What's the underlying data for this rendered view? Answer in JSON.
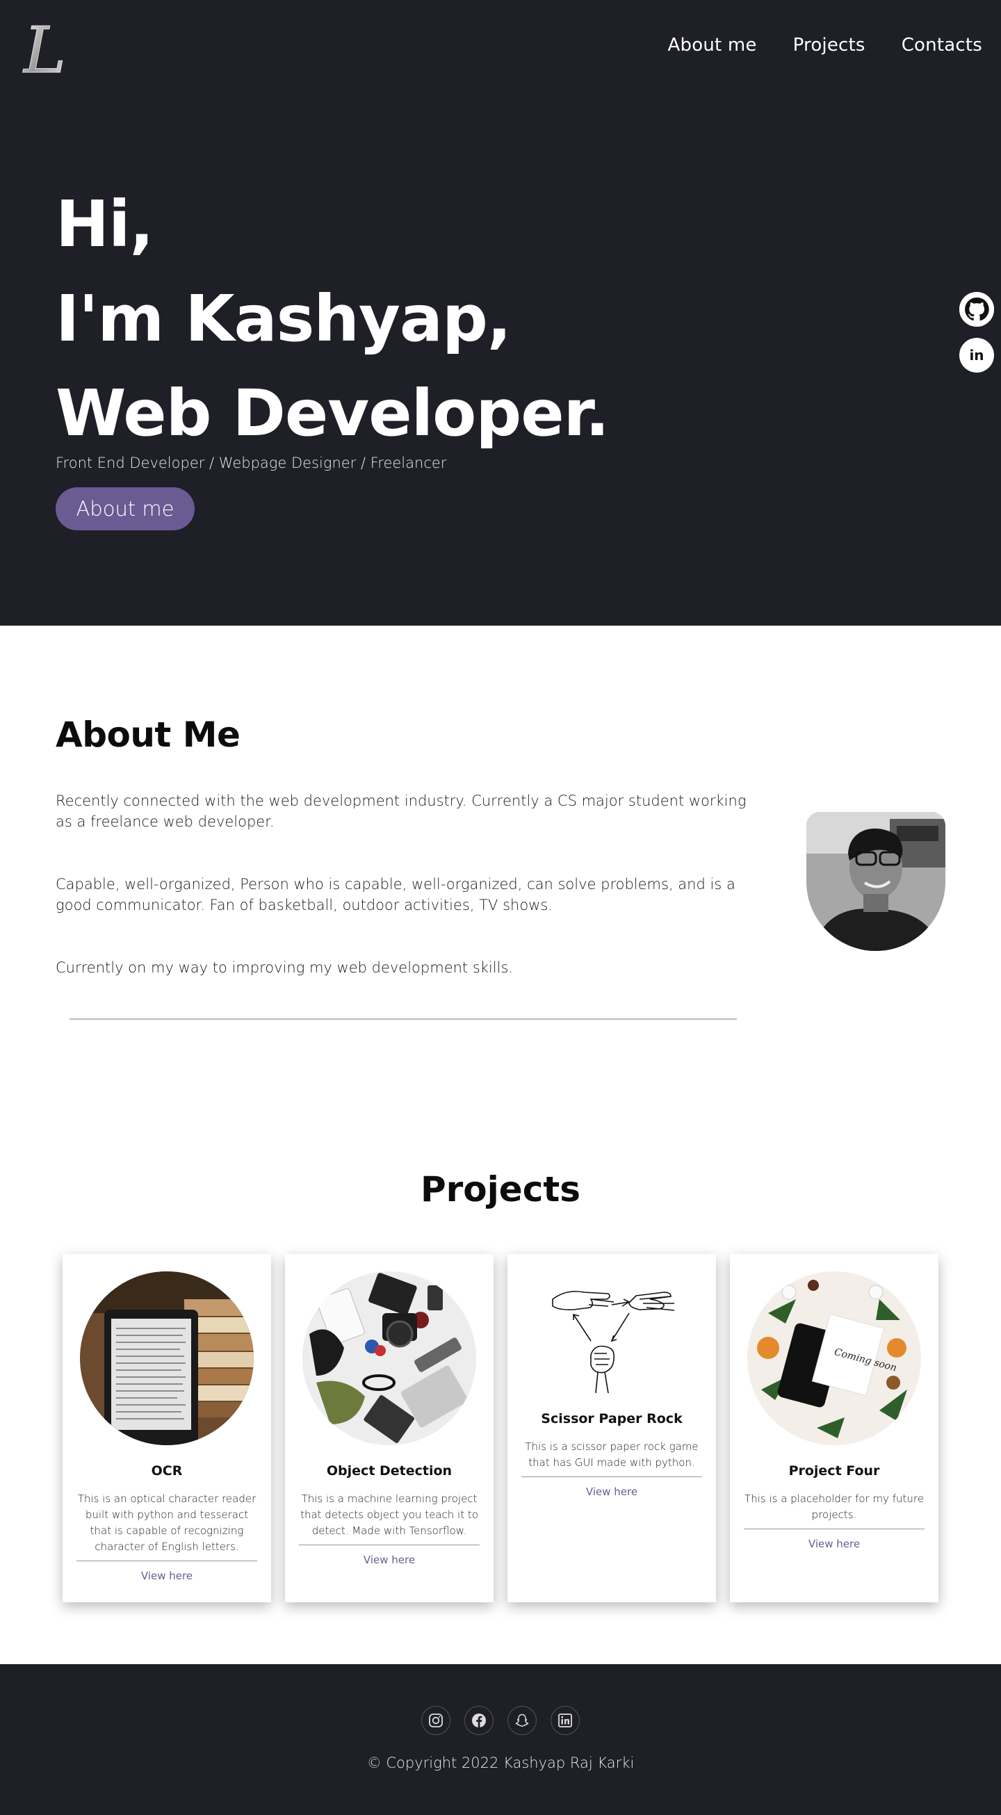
{
  "nav": {
    "logo_letter": "L",
    "links": [
      "About me",
      "Projects",
      "Contacts"
    ]
  },
  "hero": {
    "line1": "Hi,",
    "line2": "I'm Kashyap,",
    "line3": "Web Developer.",
    "subtitle": "Front End Developer / Webpage Designer / Freelancer",
    "button": "About me",
    "side_icons": [
      "github-icon",
      "linkedin-icon"
    ],
    "linkedin_text": "in"
  },
  "about": {
    "title": "About Me",
    "p1": "Recently connected with the web development industry. Currently a CS major student working as a freelance web developer.",
    "p2": "Capable, well-organized, Person who is capable, well-organized, can solve problems, and is a good communicator. Fan of basketball, outdoor activities, TV shows.",
    "p3": "Currently on my way to improving my web development skills."
  },
  "projects": {
    "title": "Projects",
    "items": [
      {
        "name": "OCR",
        "desc": "This is an optical character reader built with python and tesseract that is capable of recognizing character of English letters.",
        "link": "View here"
      },
      {
        "name": "Object Detection",
        "desc": "This is a machine learning project that detects object you teach it to detect. Made with Tensorflow.",
        "link": "View here"
      },
      {
        "name": "Scissor Paper Rock",
        "desc": "This is a scissor paper rock game that has GUI made with python.",
        "link": "View here"
      },
      {
        "name": "Project Four",
        "desc": "This is a placeholder for my future projects.",
        "link": "View here"
      }
    ],
    "coming_soon": "Coming soon"
  },
  "footer": {
    "icons": [
      "instagram-icon",
      "facebook-icon",
      "snapchat-icon",
      "linkedin-icon"
    ],
    "copyright": "© Copyright 2022 Kashyap Raj Karki"
  },
  "colors": {
    "dark_bg": "#1e1f27",
    "accent": "#6b5b93"
  }
}
